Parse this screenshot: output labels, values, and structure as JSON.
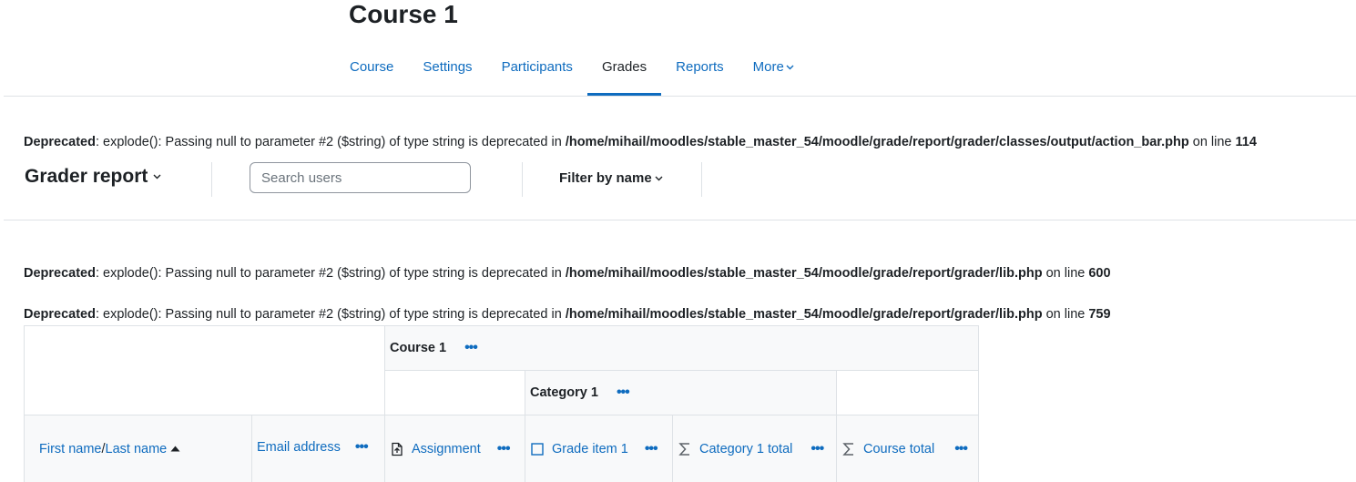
{
  "course": {
    "title": "Course 1"
  },
  "nav": {
    "items": [
      {
        "label": "Course",
        "active": false
      },
      {
        "label": "Settings",
        "active": false
      },
      {
        "label": "Participants",
        "active": false
      },
      {
        "label": "Grades",
        "active": true
      },
      {
        "label": "Reports",
        "active": false
      },
      {
        "label": "More",
        "active": false
      }
    ]
  },
  "notices": [
    {
      "prefix": "Deprecated",
      "message": ": explode(): Passing null to parameter #2 ($string) of type string is deprecated in ",
      "path": "/home/mihail/moodles/stable_master_54/moodle/grade/report/grader/classes/output/action_bar.php",
      "online": " on line ",
      "line": "114"
    },
    {
      "prefix": "Deprecated",
      "message": ": explode(): Passing null to parameter #2 ($string) of type string is deprecated in ",
      "path": "/home/mihail/moodles/stable_master_54/moodle/grade/report/grader/lib.php",
      "online": " on line ",
      "line": "600"
    },
    {
      "prefix": "Deprecated",
      "message": ": explode(): Passing null to parameter #2 ($string) of type string is deprecated in ",
      "path": "/home/mihail/moodles/stable_master_54/moodle/grade/report/grader/lib.php",
      "online": " on line ",
      "line": "759"
    }
  ],
  "action_bar": {
    "report_title": "Grader report",
    "search_placeholder": "Search users",
    "filter_label": "Filter by name"
  },
  "table": {
    "course_header": "Course 1",
    "category_header": "Category 1",
    "columns": {
      "first_name": "First name",
      "separator": " / ",
      "last_name": "Last name",
      "email": "Email address",
      "assignment": "Assignment",
      "grade_item": "Grade item 1",
      "category_total": "Category 1 total",
      "course_total": "Course total"
    }
  },
  "colors": {
    "link": "#0f6cbf",
    "text": "#1d2125",
    "border": "#dee2e6",
    "header_bg": "#f8f9fa"
  }
}
